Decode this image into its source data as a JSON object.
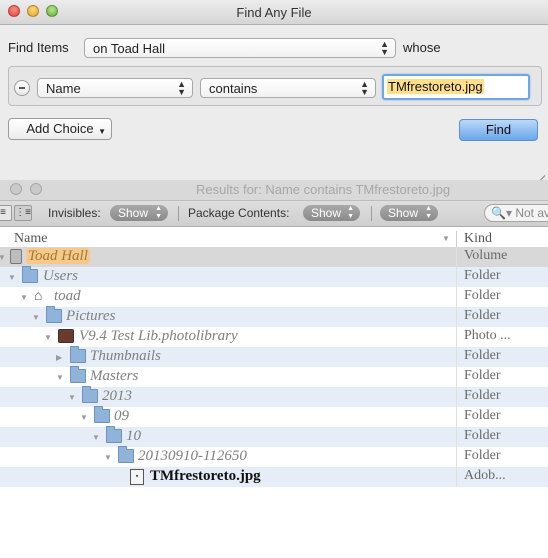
{
  "find_window": {
    "title": "Find Any File",
    "find_items_label": "Find Items",
    "location_value": "on Toad Hall",
    "whose_label": "whose",
    "attribute_value": "Name",
    "operator_value": "contains",
    "search_value": "TMfrestoreto.jpg",
    "add_choice_label": "Add Choice",
    "find_button_label": "Find"
  },
  "results_window": {
    "title": "Results for: Name contains TMfrestoreto.jpg",
    "invisibles_label": "Invisibles:",
    "invisibles_value": "Show",
    "package_contents_label": "Package Contents:",
    "package_contents_value": "Show",
    "show_value": "Show",
    "search_placeholder": "Not av",
    "columns": {
      "name": "Name",
      "kind": "Kind"
    },
    "rows": [
      {
        "name": "Toad Hall",
        "kind": "Volume",
        "icon": "drive-icon"
      },
      {
        "name": "Users",
        "kind": "Folder",
        "icon": "users-folder-icon"
      },
      {
        "name": "toad",
        "kind": "Folder",
        "icon": "home-icon"
      },
      {
        "name": "Pictures",
        "kind": "Folder",
        "icon": "pictures-folder-icon"
      },
      {
        "name": "V9.4 Test Lib.photolibrary",
        "kind": "Photo ...",
        "icon": "photo-library-icon"
      },
      {
        "name": "Thumbnails",
        "kind": "Folder",
        "icon": "folder-icon"
      },
      {
        "name": "Masters",
        "kind": "Folder",
        "icon": "folder-icon"
      },
      {
        "name": "2013",
        "kind": "Folder",
        "icon": "folder-icon"
      },
      {
        "name": "09",
        "kind": "Folder",
        "icon": "folder-icon"
      },
      {
        "name": "10",
        "kind": "Folder",
        "icon": "folder-icon"
      },
      {
        "name": "20130910-112650",
        "kind": "Folder",
        "icon": "folder-icon"
      },
      {
        "name": "TMfrestoreto.jpg",
        "kind": "Adob...",
        "icon": "image-file-icon"
      }
    ]
  }
}
